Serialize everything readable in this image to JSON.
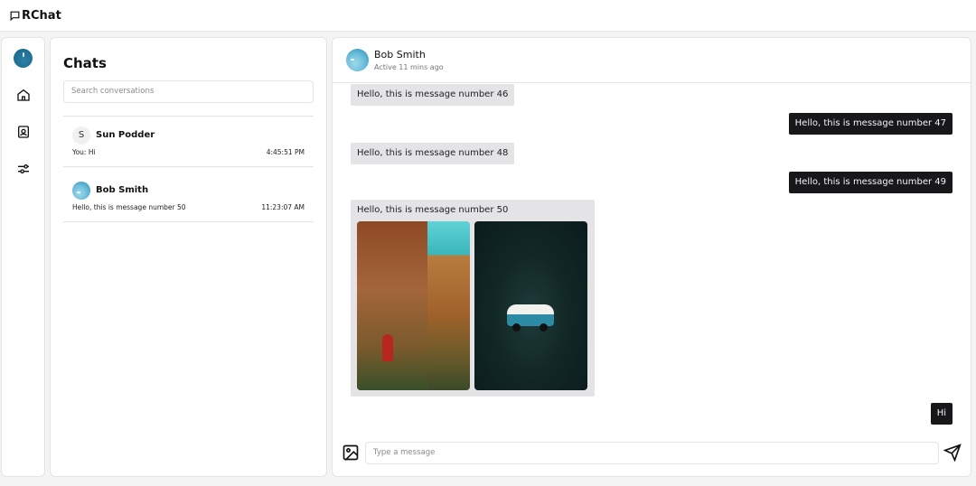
{
  "brand": {
    "name": "RChat"
  },
  "sidebar": {
    "items": [
      {
        "name": "avatar",
        "icon": "user-avatar"
      },
      {
        "name": "home",
        "icon": "home-icon"
      },
      {
        "name": "contacts",
        "icon": "contact-icon"
      },
      {
        "name": "settings",
        "icon": "sliders-icon"
      }
    ]
  },
  "chats": {
    "title": "Chats",
    "search_placeholder": "Search conversations",
    "conversations": [
      {
        "initial": "S",
        "name": "Sun Podder",
        "preview": "You: Hi",
        "time": "4:45:51 PM"
      },
      {
        "name": "Bob Smith",
        "preview": "Hello, this is message number 50",
        "time": "11:23:07 AM"
      }
    ]
  },
  "chat": {
    "contact_name": "Bob Smith",
    "status": "Active 11 mins ago",
    "messages": [
      {
        "dir": "in",
        "text": "Hello, this is message number 46"
      },
      {
        "dir": "out",
        "text": "Hello, this is message number 47"
      },
      {
        "dir": "in",
        "text": "Hello, this is message number 48"
      },
      {
        "dir": "out",
        "text": "Hello, this is message number 49"
      },
      {
        "dir": "in",
        "text": "Hello, this is message number 50"
      },
      {
        "dir": "out",
        "text": "Hi"
      }
    ],
    "composer_placeholder": "Type a message"
  },
  "colors": {
    "accent_dark": "#18181b",
    "incoming_bubble": "#e4e4e7",
    "border": "#e4e4e7"
  }
}
